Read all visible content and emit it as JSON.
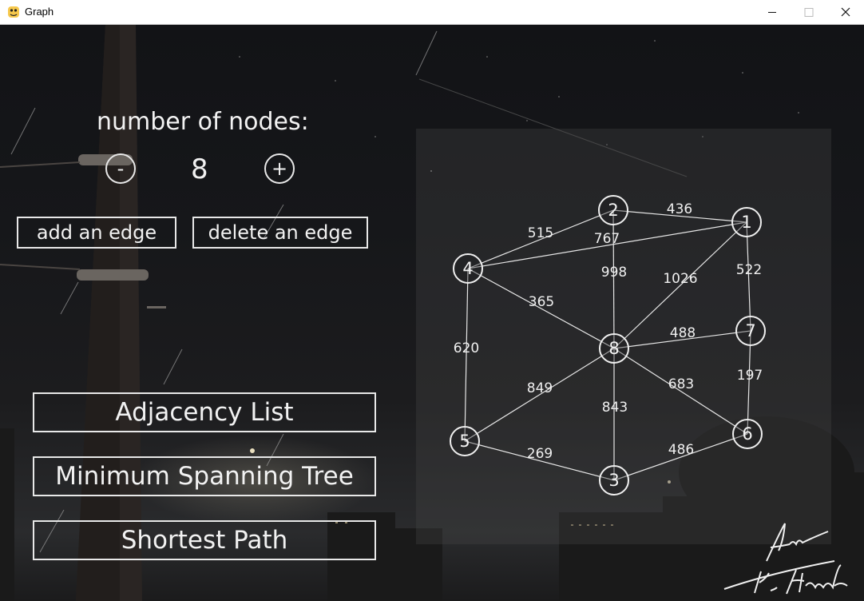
{
  "window": {
    "title": "Graph",
    "icon": "python-snake-icon"
  },
  "controls": {
    "nodes_label": "number of nodes:",
    "minus_label": "-",
    "plus_label": "+",
    "node_count": "8",
    "add_edge_label": "add an edge",
    "delete_edge_label": "delete an edge"
  },
  "actions": {
    "adjacency_list_label": "Adjacency List",
    "mst_label": "Minimum Spanning Tree",
    "shortest_path_label": "Shortest Path"
  },
  "graph": {
    "nodes": [
      "1",
      "2",
      "3",
      "4",
      "5",
      "6",
      "7",
      "8"
    ],
    "edges": [
      {
        "from": "2",
        "to": "1",
        "weight": "436"
      },
      {
        "from": "4",
        "to": "2",
        "weight": "515"
      },
      {
        "from": "4",
        "to": "1",
        "weight": "767"
      },
      {
        "from": "2",
        "to": "8",
        "weight": "998"
      },
      {
        "from": "8",
        "to": "1",
        "weight": "1026"
      },
      {
        "from": "1",
        "to": "7",
        "weight": "522"
      },
      {
        "from": "4",
        "to": "8",
        "weight": "365"
      },
      {
        "from": "4",
        "to": "5",
        "weight": "620"
      },
      {
        "from": "8",
        "to": "7",
        "weight": "488"
      },
      {
        "from": "7",
        "to": "6",
        "weight": "197"
      },
      {
        "from": "8",
        "to": "5",
        "weight": "849"
      },
      {
        "from": "8",
        "to": "3",
        "weight": "843"
      },
      {
        "from": "8",
        "to": "6",
        "weight": "683"
      },
      {
        "from": "5",
        "to": "3",
        "weight": "269"
      },
      {
        "from": "3",
        "to": "6",
        "weight": "486"
      }
    ]
  },
  "signature": {
    "text": "Am K. Hanada"
  },
  "colors": {
    "foreground": "#f2f2f2",
    "panel": "#46464852",
    "titlebar": "#ffffff"
  }
}
